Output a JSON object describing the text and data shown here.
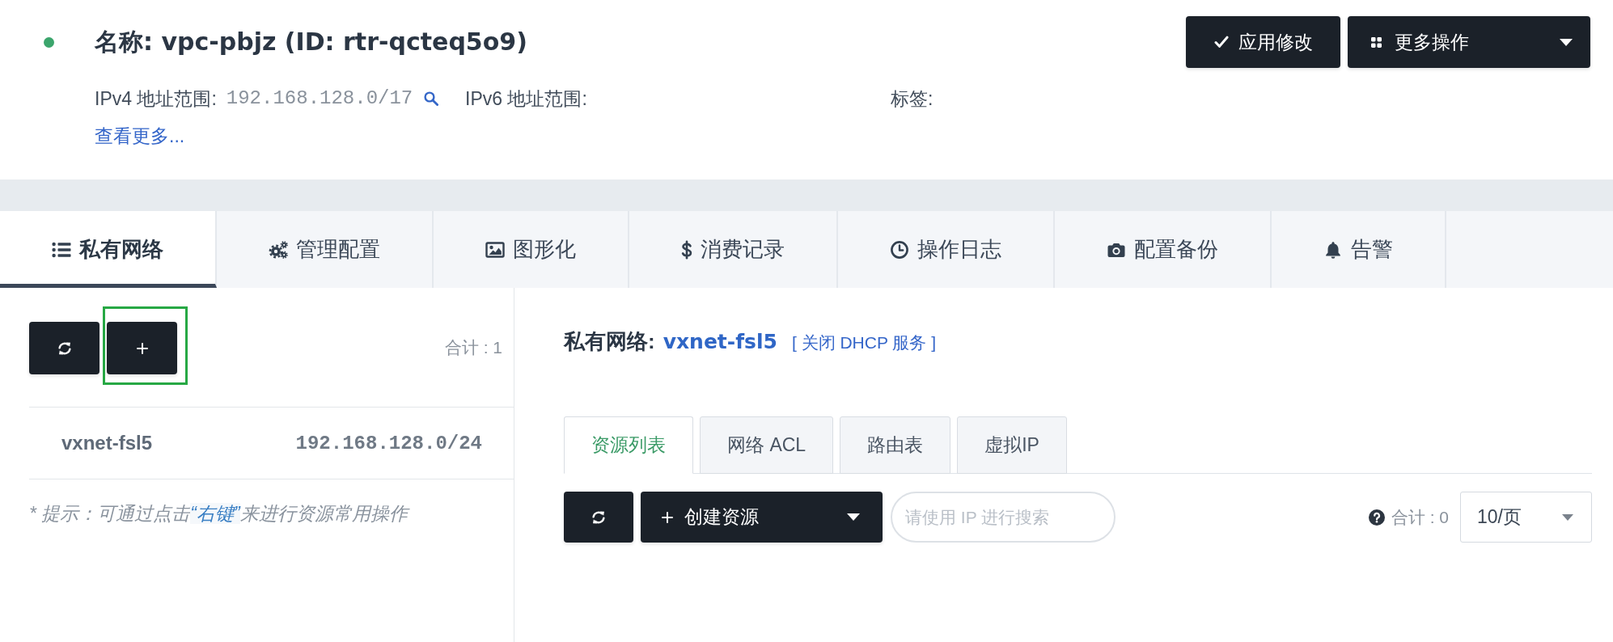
{
  "header": {
    "title": "名称: vpc-pbjz (ID: rtr-qcteq5o9)",
    "actions": [
      {
        "kind": "apply",
        "label": "应用修改"
      },
      {
        "kind": "menu",
        "label": "更多操作"
      }
    ],
    "fields": [
      {
        "label": "IPv4 地址范围:",
        "value": "192.168.128.0/17",
        "searchable": true
      },
      {
        "label": "IPv6 地址范围:",
        "searchable": false
      },
      {
        "label": "标签:",
        "searchable": false
      }
    ],
    "more_link": "查看更多..."
  },
  "tabs": [
    {
      "label": "私有网络",
      "selected": true
    },
    {
      "label": "管理配置",
      "selected": false
    },
    {
      "label": "图形化",
      "selected": false
    },
    {
      "label": "消费记录",
      "selected": false
    },
    {
      "label": "操作日志",
      "selected": false
    },
    {
      "label": "配置备份",
      "selected": false
    },
    {
      "label": "告警",
      "selected": false
    }
  ],
  "vxnet_list": {
    "add_highlighted": true,
    "total": "合计 : 1",
    "rows": [
      {
        "name": "vxnet-fsl5",
        "cidr": "192.168.128.0/24"
      }
    ],
    "hint": {
      "before": "* 提示：可通过点击",
      "emphasis": "“右键”",
      "after": "来进行资源常用操作"
    }
  },
  "detail": {
    "label": "私有网络:",
    "name": "vxnet-fsl5",
    "action": "[ 关闭 DHCP 服务 ]",
    "subtabs": [
      {
        "label": "资源列表",
        "selected": true
      },
      {
        "label": "网络 ACL",
        "selected": false
      },
      {
        "label": "路由表",
        "selected": false
      },
      {
        "label": "虚拟IP",
        "selected": false
      }
    ],
    "toolbar": {
      "create_label": "创建资源",
      "search_placeholder": "请使用 IP 进行搜索",
      "total": "合计 : 0",
      "page_size": "10/页"
    }
  }
}
